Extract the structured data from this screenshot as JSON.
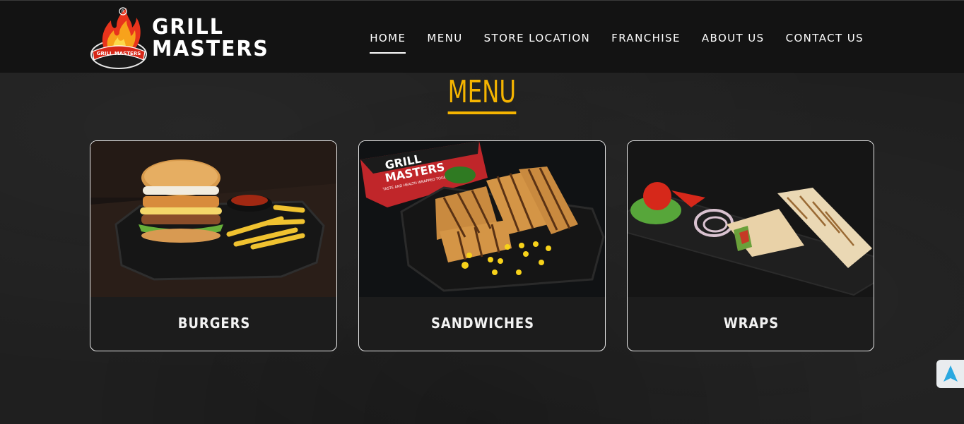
{
  "brand": {
    "line1": "GRILL",
    "line2": "MASTERS",
    "emblem_text": "GRILL MASTERS",
    "reg_mark": "®"
  },
  "nav": {
    "items": [
      {
        "label": "HOME",
        "active": true
      },
      {
        "label": "MENU",
        "active": false
      },
      {
        "label": "STORE LOCATION",
        "active": false
      },
      {
        "label": "FRANCHISE",
        "active": false
      },
      {
        "label": "ABOUT US",
        "active": false
      },
      {
        "label": "CONTACT US",
        "active": false
      }
    ]
  },
  "section": {
    "title": "MENU"
  },
  "cards": [
    {
      "label": "BURGERS",
      "image": "burger-fries-plate"
    },
    {
      "label": "SANDWICHES",
      "image": "grilled-sandwich-plate",
      "box_text_1": "GRILL",
      "box_text_2": "MASTERS",
      "box_tagline": "TASTE AND HEALTH WRAPPED TOGETHER"
    },
    {
      "label": "WRAPS",
      "image": "wraps-plate"
    }
  ],
  "colors": {
    "accent": "#f5b400",
    "background": "#1f1f1f",
    "header": "#131313",
    "scroll_arrow": "#2aa8e0"
  },
  "scroll_top": {
    "icon": "arrow-up-icon"
  }
}
